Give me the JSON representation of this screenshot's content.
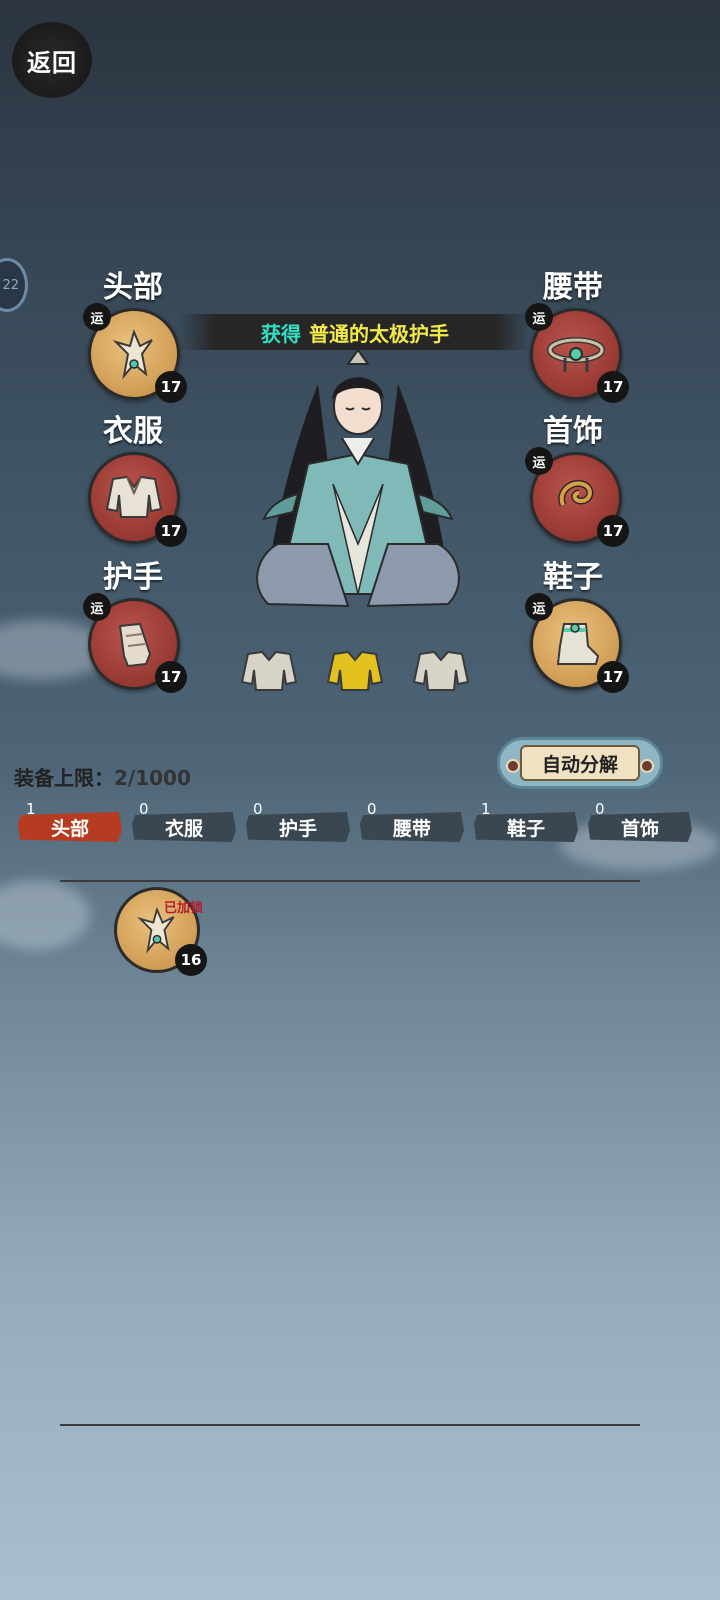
{
  "header": {
    "back_label": "返回",
    "side_badge_text": "22"
  },
  "banner": {
    "get_text": "获得",
    "item_name": "普通的太极护手"
  },
  "slots": {
    "head": {
      "label": "头部",
      "level": "17",
      "yun": "运"
    },
    "clothes": {
      "label": "衣服",
      "level": "17"
    },
    "gloves": {
      "label": "护手",
      "level": "17",
      "yun": "运"
    },
    "belt": {
      "label": "腰带",
      "level": "17",
      "yun": "运"
    },
    "accessory": {
      "label": "首饰",
      "level": "17",
      "yun": "运"
    },
    "shoes": {
      "label": "鞋子",
      "level": "17",
      "yun": "运"
    }
  },
  "equip_limit": {
    "label": "装备上限：",
    "value": "2/1000"
  },
  "auto_button": {
    "label": "自动分解"
  },
  "tabs": [
    {
      "label": "头部",
      "count": "1",
      "active": true
    },
    {
      "label": "衣服",
      "count": "0"
    },
    {
      "label": "护手",
      "count": "0"
    },
    {
      "label": "腰带",
      "count": "0"
    },
    {
      "label": "鞋子",
      "count": "1"
    },
    {
      "label": "首饰",
      "count": "0"
    }
  ],
  "inventory": [
    {
      "level": "16",
      "lock_label": "已加锁",
      "icon": "headpiece-icon"
    }
  ],
  "colors": {
    "active_tab": "#b53c20",
    "banner_get": "#34e0c4",
    "banner_item": "#f2ea4a",
    "lock": "#b51c2e"
  }
}
